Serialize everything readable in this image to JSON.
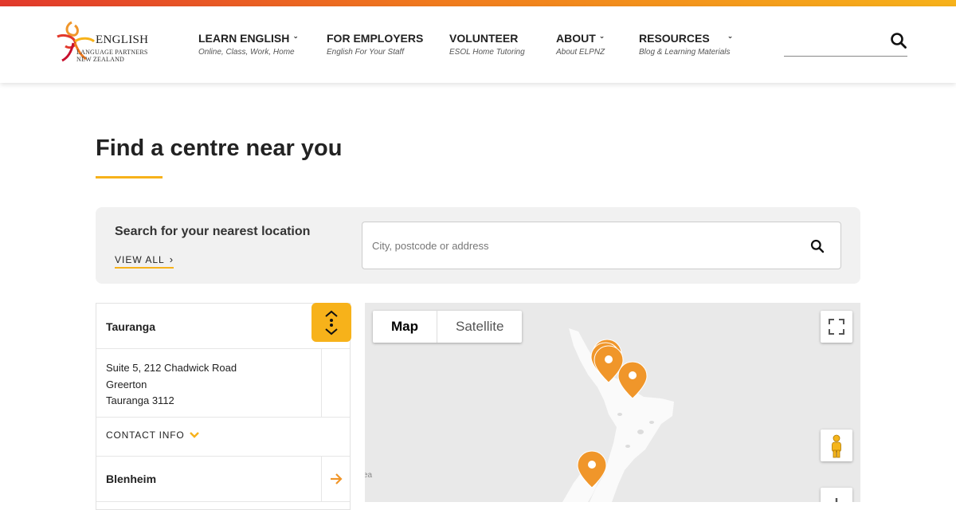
{
  "colors": {
    "accent": "#f7b21a",
    "pin": "#f0962a",
    "gradient_start": "#e2392c",
    "gradient_end": "#f7b21a"
  },
  "logo": {
    "line1": "ENGLISH",
    "line2": "LANGUAGE PARTNERS",
    "line3": "NEW ZEALAND"
  },
  "nav": [
    {
      "title": "LEARN ENGLISH",
      "sub": "Online, Class, Work, Home",
      "has_menu": true
    },
    {
      "title": "FOR EMPLOYERS",
      "sub": "English For Your Staff",
      "has_menu": false
    },
    {
      "title": "VOLUNTEER",
      "sub": "ESOL Home Tutoring",
      "has_menu": false
    },
    {
      "title": "ABOUT",
      "sub": "About ELPNZ",
      "has_menu": true
    },
    {
      "title": "RESOURCES",
      "sub": "Blog & Learning Materials",
      "has_menu": true
    }
  ],
  "header_search": {
    "icon": "search-icon",
    "value": ""
  },
  "page": {
    "title": "Find a centre near you"
  },
  "search_panel": {
    "label": "Search for your nearest location",
    "view_all": "VIEW ALL",
    "input_placeholder": "City, postcode or address",
    "input_value": ""
  },
  "locations": {
    "active": {
      "name": "Tauranga",
      "address": [
        "Suite 5, 212 Chadwick Road",
        "Greerton",
        "Tauranga  3112"
      ],
      "contact_label": "CONTACT INFO"
    },
    "next": {
      "name": "Blenheim"
    }
  },
  "map": {
    "type_buttons": [
      "Map",
      "Satellite"
    ],
    "selected_type": "Map",
    "sea_label": "ea",
    "controls": [
      "fullscreen-icon",
      "pegman-icon",
      "zoom-in-icon"
    ]
  }
}
